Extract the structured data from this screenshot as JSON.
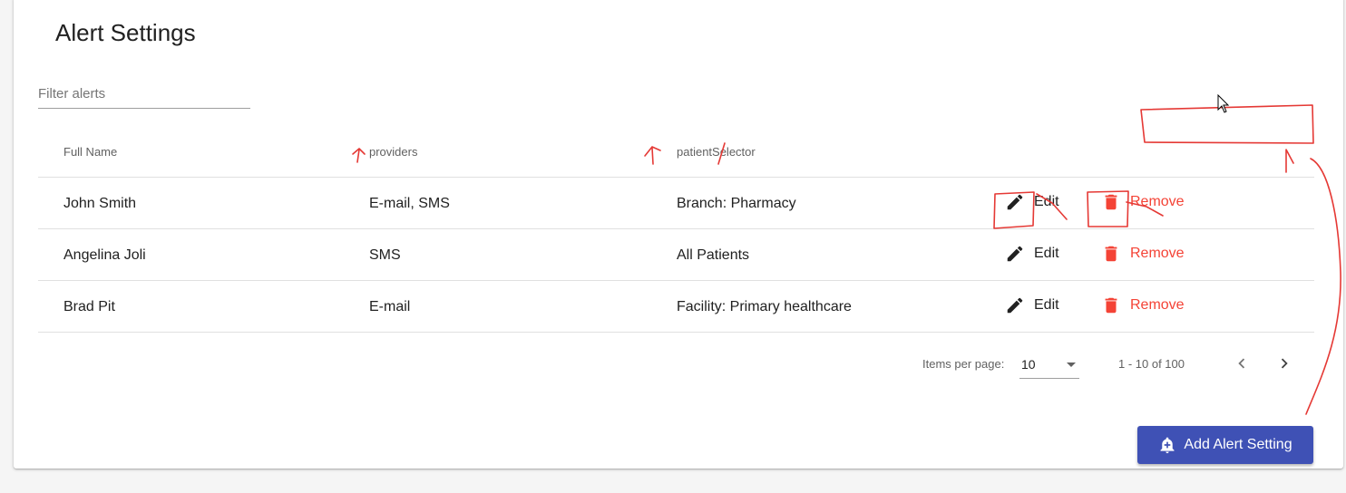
{
  "page": {
    "title": "Alert Settings"
  },
  "filter": {
    "placeholder": "Filter alerts",
    "value": ""
  },
  "table": {
    "columns": [
      "Full Name",
      "providers",
      "patientSelector"
    ],
    "rows": [
      {
        "full_name": "John Smith",
        "providers": "E-mail, SMS",
        "patient_selector": "Branch: Pharmacy",
        "edit_label": "Edit",
        "remove_label": "Remove"
      },
      {
        "full_name": "Angelina Joli",
        "providers": "SMS",
        "patient_selector": "All Patients",
        "edit_label": "Edit",
        "remove_label": "Remove"
      },
      {
        "full_name": "Brad Pit",
        "providers": "E-mail",
        "patient_selector": "Facility: Primary healthcare",
        "edit_label": "Edit",
        "remove_label": "Remove"
      }
    ],
    "edit_icon": "pencil-icon",
    "remove_icon": "trash-icon"
  },
  "paginator": {
    "items_per_page_label": "Items per page:",
    "items_per_page_value": "10",
    "range_label": "1 - 10 of 100",
    "prev_icon": "chevron-left-icon",
    "next_icon": "chevron-right-icon"
  },
  "actions": {
    "add_label": "Add Alert Setting",
    "add_icon": "add-alert-bell-icon"
  },
  "colors": {
    "primary": "#3f51b5",
    "warn": "#f44336",
    "annotation": "#e53935"
  }
}
